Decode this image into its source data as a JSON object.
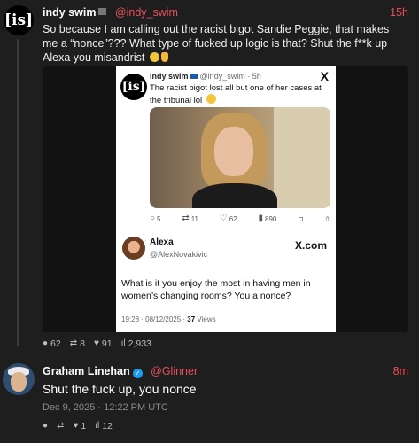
{
  "post1": {
    "avatar_text": "[is]",
    "name": "indy swim",
    "handle": "@indy_swim",
    "time": "15h",
    "text": "So because I am calling out the racist bigot Sandie Peggie, that makes me a “nonce”??? What type of fucked up logic is that? Shut the f**k up Alexa you misandrist",
    "stats": {
      "replies": "62",
      "reposts": "8",
      "likes": "91",
      "views": "2,933"
    }
  },
  "screenshot_card": {
    "quoted": {
      "avatar_text": "[is]",
      "name": "indy swim",
      "handle_time": "@indy_swim · 5h",
      "logo": "X",
      "text": "The racist bigot lost all but one of her cases at the tribunal lol",
      "actions": {
        "replies": "5",
        "reposts": "11",
        "likes": "62",
        "views": "890"
      }
    },
    "reply": {
      "name": "Alexa",
      "handle": "@AlexNovakivic",
      "brand": "X.com",
      "text": "What is it you enjoy the most in having men in women’s changing rooms? You a nonce?",
      "time_date": "19:28 · 08/12/2025 · ",
      "views_count": "37",
      "views_label": " Views"
    }
  },
  "post2": {
    "name": "Graham Linehan",
    "handle": "@Glinner",
    "time": "8m",
    "text": "Shut the fuck up, you nonce",
    "date": "Dec 9, 2025 · 12:22 PM UTC",
    "stats": {
      "replies": "",
      "reposts": "",
      "likes": "1",
      "views": "12"
    }
  },
  "colors": {
    "accent": "#e8505b",
    "background": "#1e1e1e",
    "verified": "#1d9bf0"
  }
}
